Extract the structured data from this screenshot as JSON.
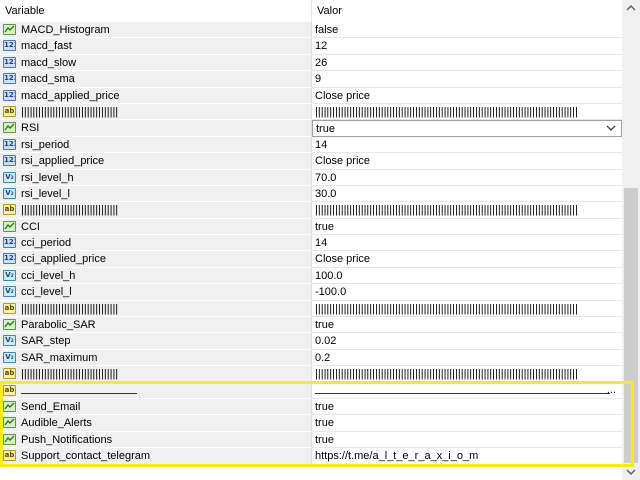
{
  "header": {
    "col_variable": "Variable",
    "col_value": "Valor"
  },
  "rows": [
    {
      "type": "bool",
      "name": "MACD_Histogram",
      "value": "false"
    },
    {
      "type": "int",
      "name": "macd_fast",
      "value": "12"
    },
    {
      "type": "int",
      "name": "macd_slow",
      "value": "26"
    },
    {
      "type": "int",
      "name": "macd_sma",
      "value": "9"
    },
    {
      "type": "int",
      "name": "macd_applied_price",
      "value": "Close price"
    },
    {
      "type": "str",
      "name": "||||||||||||||||||||||||||||||||||",
      "value": "||||||||||||||||||||||||||||||||||||||||||||||||||||||||||||||||||||||||||||||||||||||||||||"
    },
    {
      "type": "bool",
      "name": "RSI",
      "value": "true",
      "selected": true
    },
    {
      "type": "int",
      "name": "rsi_period",
      "value": "14"
    },
    {
      "type": "int",
      "name": "rsi_applied_price",
      "value": "Close price"
    },
    {
      "type": "dbl",
      "name": "rsi_level_h",
      "value": "70.0"
    },
    {
      "type": "dbl",
      "name": "rsi_level_l",
      "value": "30.0"
    },
    {
      "type": "str",
      "name": "||||||||||||||||||||||||||||||||||",
      "value": "||||||||||||||||||||||||||||||||||||||||||||||||||||||||||||||||||||||||||||||||||||||||||||"
    },
    {
      "type": "bool",
      "name": "CCI",
      "value": "true"
    },
    {
      "type": "int",
      "name": "cci_period",
      "value": "14"
    },
    {
      "type": "int",
      "name": "cci_applied_price",
      "value": "Close price"
    },
    {
      "type": "dbl",
      "name": "cci_level_h",
      "value": "100.0"
    },
    {
      "type": "dbl",
      "name": "cci_level_l",
      "value": "-100.0"
    },
    {
      "type": "str",
      "name": "||||||||||||||||||||||||||||||||||",
      "value": "||||||||||||||||||||||||||||||||||||||||||||||||||||||||||||||||||||||||||||||||||||||||||||"
    },
    {
      "type": "bool",
      "name": "Parabolic_SAR",
      "value": "true"
    },
    {
      "type": "dbl",
      "name": "SAR_step",
      "value": "0.02"
    },
    {
      "type": "dbl",
      "name": "SAR_maximum",
      "value": "0.2"
    },
    {
      "type": "str",
      "name": "||||||||||||||||||||||||||||||||||",
      "value": "||||||||||||||||||||||||||||||||||||||||||||||||||||||||||||||||||||||||||||||||||||||||||||"
    },
    {
      "type": "str",
      "name": "",
      "value": "...",
      "underline": true
    },
    {
      "type": "bool",
      "name": "Send_Email",
      "value": "true"
    },
    {
      "type": "bool",
      "name": "Audible_Alerts",
      "value": "true"
    },
    {
      "type": "bool",
      "name": "Push_Notifications",
      "value": "true"
    },
    {
      "type": "str",
      "name": "Support_contact_telegram",
      "value": "https://t.me/a_l_t_e_r_a_x_i_o_m"
    }
  ],
  "icons": {
    "bool": "chart-line-icon",
    "int": "integer-123-icon",
    "dbl": "double-value-icon",
    "str": "string-ab-icon"
  },
  "icon_glyphs": {
    "bool": "⟋",
    "int": "123",
    "dbl": "V₂",
    "str": "ab"
  },
  "colors": {
    "highlight_border": "#f5ec21",
    "name_bg": "#f0f0f0"
  }
}
